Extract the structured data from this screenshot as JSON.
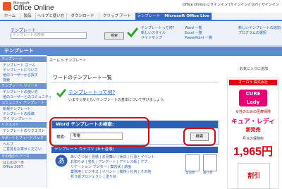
{
  "header": {
    "brand_ms": "Microsoft",
    "brand_name": "Office Online",
    "signin_text": "Office Online にサインイン (サインインとは?) | サインイン",
    "tabs": [
      "ホーム",
      "製品",
      "ヘルプと使い方",
      "ダウンロード",
      "クリップ アート",
      "テンプレート",
      "Microsoft Office Live"
    ],
    "active_tab_index": 5
  },
  "search": {
    "label": "テンプレート",
    "placeholder": "テンプレートの検索",
    "button": "検索",
    "links_col1": [
      "テンプレートって何?",
      "新しいスタイル",
      "サイトマップ"
    ],
    "links_col2": [
      "Word 一覧",
      "Excel 一覧",
      "PowerPoint 一覧"
    ],
    "links_col3": [
      "新しいテンプレートの追加",
      "プログラムの選択"
    ]
  },
  "section": {
    "title": "テンプレート"
  },
  "leftnav": {
    "groups": [
      {
        "head": "テンプレート",
        "items": [
          "テンプレート ホーム",
          "テンプレートについて",
          "他のユーザーから探す",
          "検索"
        ]
      },
      {
        "head": "テンプレート リソース",
        "items": [
          "テンプレートの使い方",
          "他のユーザーとのコミュニティ"
        ]
      },
      {
        "head": "コミュニティ テンプレート",
        "items": [
          "新規テンプレート",
          "テンプレートの投稿",
          "マイ テンプレート"
        ]
      },
      {
        "head": "リクエスト",
        "items": [
          "テンプレートのリクエスト"
        ]
      },
      {
        "head": "サポートとフィードバック",
        "items": [
          "ヘルプ",
          "ご意見をお寄せください"
        ]
      },
      {
        "head": "その他のリソース",
        "items": [
          "はじめの一歩",
          "Office 2007"
        ]
      }
    ]
  },
  "main": {
    "breadcrumb": "ホーム > テンプレート",
    "bookmark": "お気に入りに追加",
    "page_title": "ワードのテンプレート一覧",
    "tip_title": "テンプレートって何?",
    "tip_sub": "いますぐ使えないテンプレートの基本について学びましょう。",
    "search_panel_title": "Word テンプレートの検索:",
    "search_panel_label": "検索:",
    "search_panel_value": "弔電",
    "search_panel_button": "検索",
    "categories_head": "テンプレート カテゴリ (五十音順)",
    "category_lines": [
      "あいさつ状 | 見積 | お見舞い | 休日 | 行事とイベント",
      "お知らせ | 名札 | アンケート | アドレス帳 | アプ",
      "リケーション ブンター | 案内状 | 絵画",
      "業務用 | ビジネス | イベント | 挨拶 | 社内 | その他",
      "折り紙プロジェクト | 送り状"
    ],
    "popular_head": "人気カテゴリ",
    "popular_items": [
      "案内状",
      "送り状"
    ]
  },
  "ad": {
    "brand": "オーロラ 株式会社",
    "product": "CURE Lady",
    "line1": "女性のための医療保険",
    "line2": "キュア・レディ",
    "line3": "新発売",
    "line4": "月々の保険料",
    "price": "1,965円",
    "pack": "割引"
  }
}
